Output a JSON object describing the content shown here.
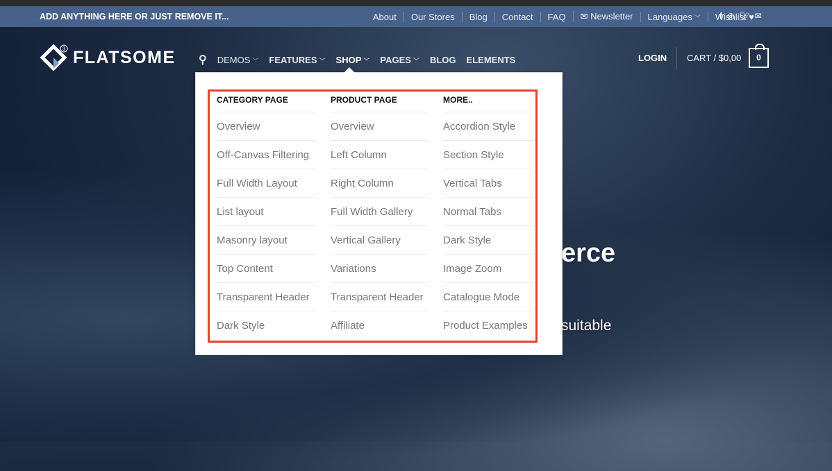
{
  "topbar": {
    "promo": "ADD ANYTHING HERE OR JUST REMOVE IT...",
    "links": [
      "About",
      "Our Stores",
      "Blog",
      "Contact",
      "FAQ"
    ],
    "newsletter": "Newsletter",
    "languages": "Languages",
    "wishlist": "Wishlist",
    "social_icons": [
      "facebook-icon",
      "instagram-icon",
      "twitter-icon",
      "email-icon"
    ]
  },
  "header": {
    "logo": "FLATSOME",
    "logo_badge": "3",
    "nav": [
      {
        "label": "DEMOS",
        "dropdown": true
      },
      {
        "label": "FEATURES",
        "dropdown": true
      },
      {
        "label": "SHOP",
        "dropdown": true,
        "active": true
      },
      {
        "label": "PAGES",
        "dropdown": true
      },
      {
        "label": "BLOG"
      },
      {
        "label": "ELEMENTS"
      }
    ],
    "login": "LOGIN",
    "cart": "CART / $0,00",
    "cart_count": "0"
  },
  "hero": {
    "title_fragment": "erce",
    "text_fragment": "suitable"
  },
  "dropdown": {
    "highlight_color": "#e5432d",
    "columns": [
      {
        "heading": "CATEGORY PAGE",
        "items": [
          "Overview",
          "Off-Canvas Filtering",
          "Full Width Layout",
          "List layout",
          "Masonry layout",
          "Top Content",
          "Transparent Header",
          "Dark Style"
        ]
      },
      {
        "heading": "PRODUCT PAGE",
        "items": [
          "Overview",
          "Left Column",
          "Right Column",
          "Full Width Gallery",
          "Vertical Gallery",
          "Variations",
          "Transparent Header",
          "Affiliate"
        ]
      },
      {
        "heading": "MORE..",
        "items": [
          "Accordion Style",
          "Section Style",
          "Vertical Tabs",
          "Normal Tabs",
          "Dark Style",
          "Image Zoom",
          "Catalogue Mode",
          "Product Examples"
        ]
      }
    ]
  }
}
